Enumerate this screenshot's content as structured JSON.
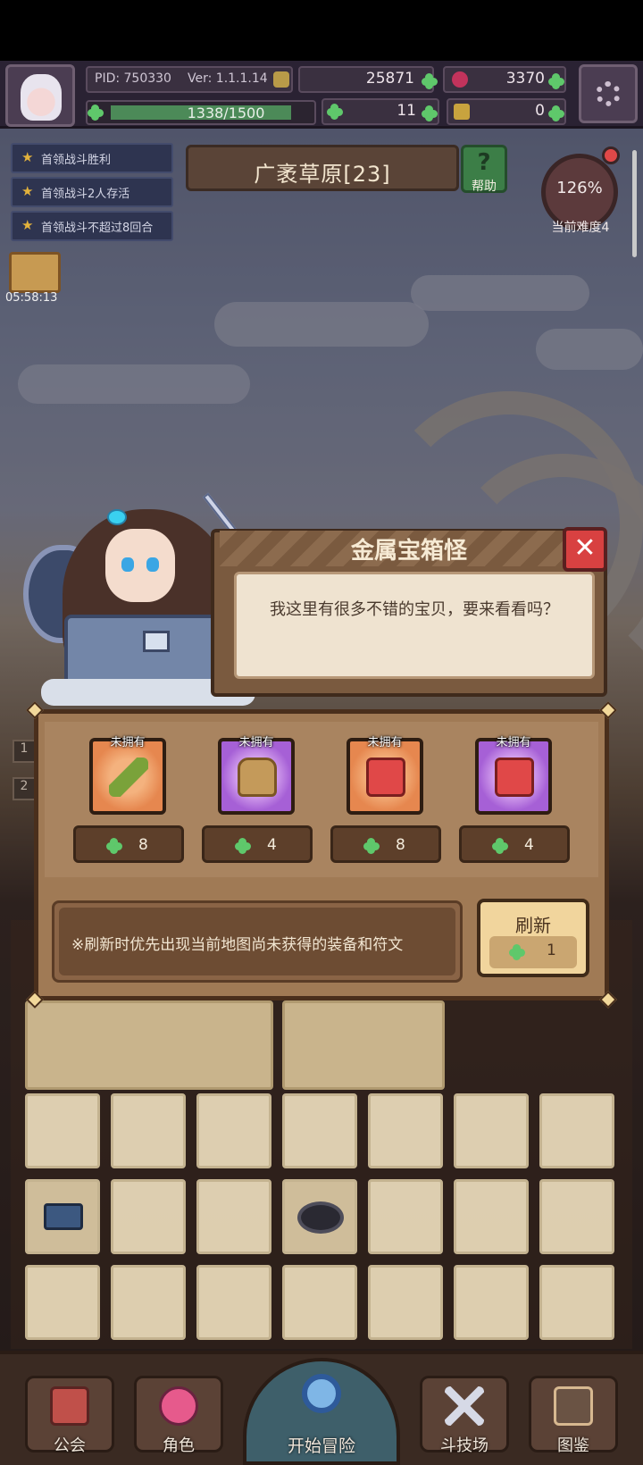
{
  "header": {
    "pid": "PID: 750330",
    "version": "Ver: 1.1.1.14",
    "gold": "25871",
    "gems": "3370",
    "xp": "1338/1500",
    "xp_progress": 0.892,
    "clover": "11",
    "keys": "0"
  },
  "quests": [
    {
      "label": "首领战斗胜利"
    },
    {
      "label": "首领战斗2人存活"
    },
    {
      "label": "首领战斗不超过8回合"
    }
  ],
  "gift_timer": "05:58:13",
  "stage": {
    "title": "广袤草原[23]",
    "help_label": "帮助",
    "difficulty_percent": "126%",
    "difficulty_label": "当前难度4"
  },
  "dialog": {
    "title": "金属宝箱怪",
    "text": "我这里有很多不错的宝贝，要来看看吗？"
  },
  "shop": {
    "items": [
      {
        "badge": "未拥有",
        "price": "8",
        "icon": "green-dagger-icon",
        "frame": "orange"
      },
      {
        "badge": "未拥有",
        "price": "4",
        "icon": "leather-armor-icon",
        "frame": "purple"
      },
      {
        "badge": "未拥有",
        "price": "8",
        "icon": "red-rune-horseshoe-icon",
        "frame": "orange"
      },
      {
        "badge": "未拥有",
        "price": "4",
        "icon": "red-rune-drop-icon",
        "frame": "purple"
      }
    ],
    "tip": "※刷新时优先出现当前地图尚未获得的装备和符文",
    "refresh_label": "刷新",
    "refresh_cost": "1"
  },
  "side_numbers": [
    "1",
    "2"
  ],
  "nav": [
    {
      "label": "公会",
      "icon": "guild-hall-icon"
    },
    {
      "label": "角色",
      "icon": "character-icon"
    },
    {
      "label": "开始冒险",
      "icon": "magnifier-icon"
    },
    {
      "label": "斗技场",
      "icon": "crossed-swords-icon"
    },
    {
      "label": "图鉴",
      "icon": "codex-book-icon"
    }
  ],
  "colors": {
    "accent_green": "#5fc86b",
    "close_red": "#d84141",
    "panel_brown": "#a07a55",
    "card_orange": "#e6874f",
    "card_purple": "#a660d6"
  }
}
